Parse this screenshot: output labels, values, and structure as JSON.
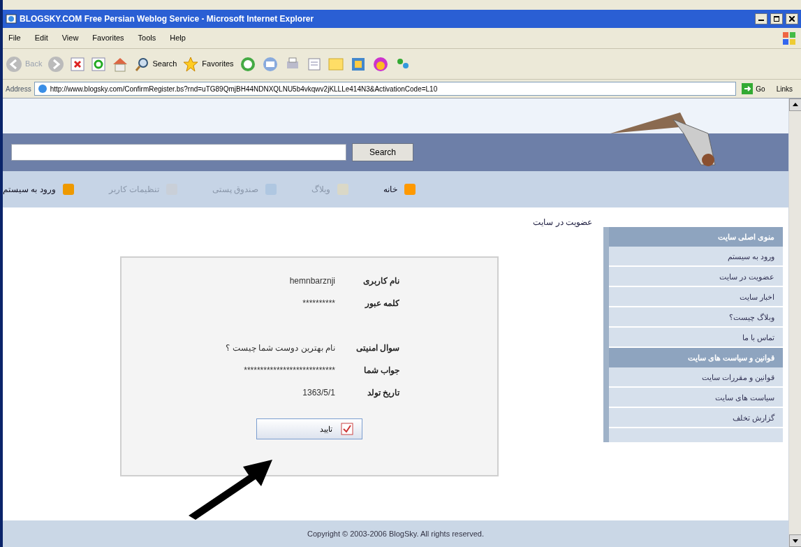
{
  "window": {
    "title": "BLOGSKY.COM Free Persian Weblog Service - Microsoft Internet Explorer"
  },
  "menu_bar": {
    "file": "File",
    "edit": "Edit",
    "view": "View",
    "favorites": "Favorites",
    "tools": "Tools",
    "help": "Help"
  },
  "toolbar": {
    "back": "Back",
    "search": "Search",
    "favorites": "Favorites"
  },
  "address_bar": {
    "label": "Address",
    "value": "http://www.blogsky.com/ConfirmRegister.bs?rnd=uTG89QmjBH44NDNXQLNU5b4vkqwv2jKLLLe414N3&ActivationCode=L10",
    "go": "Go",
    "links": "Links"
  },
  "site_search": {
    "button": "Search"
  },
  "nav": [
    {
      "label": "خانه",
      "disabled": false
    },
    {
      "label": "وبلاگ",
      "disabled": true
    },
    {
      "label": "صندوق پستی",
      "disabled": true
    },
    {
      "label": "تنظیمات کاربر",
      "disabled": true
    },
    {
      "label": "ورود به سیستم",
      "disabled": false
    }
  ],
  "breadcrumb": "عضویت در سایت",
  "sidebar": [
    {
      "heading": "منوی اصلی سایت",
      "items": [
        "ورود به سیستم",
        "عضویت در سایت",
        "اخبار سایت",
        "وبلاگ چیست؟",
        "تماس با ما"
      ]
    },
    {
      "heading": "قوانین و سیاست های سایت",
      "items": [
        "قوانین و مقررات سایت",
        "سیاست های سایت",
        "گزارش تخلف"
      ]
    }
  ],
  "form": {
    "rows": [
      {
        "label": "نام کاربری",
        "value": "hemnbarznji"
      },
      {
        "label": "کلمه عبور",
        "value": "**********"
      },
      {
        "label": "سوال امنیتی",
        "value": "نام بهترین دوست شما چیست ؟"
      },
      {
        "label": "جواب شما",
        "value": "****************************"
      },
      {
        "label": "تاریخ تولد",
        "value": "1363/5/1"
      }
    ],
    "submit": "تایید"
  },
  "footer": "Copyright © 2003-2006 BlogSky. All rights reserved."
}
